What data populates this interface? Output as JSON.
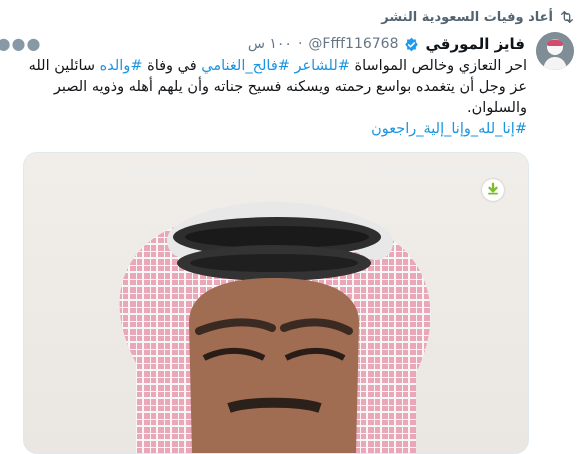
{
  "retweet": {
    "label": "أعاد وفيات السعودية النشر",
    "icon": "retweet-icon"
  },
  "tweet": {
    "display_name": "فايز المورقي",
    "handle": "@Ffff116768",
    "separator": "·",
    "time": "١٠٠ س",
    "verified": true,
    "more_icon": "more-icon",
    "text_parts": [
      {
        "type": "text",
        "value": "احر التعازي وخالص المواساة "
      },
      {
        "type": "tag",
        "value": "#للشاعر"
      },
      {
        "type": "text",
        "value": " "
      },
      {
        "type": "tag",
        "value": "#فالح_الغنامي"
      },
      {
        "type": "text",
        "value": " في وفاة "
      },
      {
        "type": "tag",
        "value": "#والده"
      },
      {
        "type": "text",
        "value": " سائلين الله عز وجل أن يتغمده بواسع رحمته ويسكنه فسيح جناته وأن يلهم أهله وذويه الصبر والسلوان."
      }
    ],
    "last_line_tag": "#إنا_لله_وإنا_إلية_راجعون",
    "media": {
      "download_icon": "download-icon"
    }
  },
  "colors": {
    "link": "#1b95e0",
    "verified": "#1d9bf0",
    "download": "#7cbd2a",
    "keffiyeh": "#e9a7b7"
  }
}
